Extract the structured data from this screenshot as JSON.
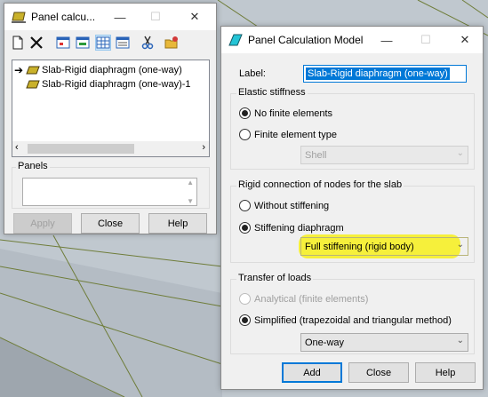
{
  "colors": {
    "accent": "#0078d7",
    "highlight": "#f6ef30",
    "slab_icon": "#c9b12a"
  },
  "small_window": {
    "title": "Panel calcu...",
    "toolbar": [
      "new-icon",
      "delete-icon",
      "view-icon-1",
      "view-icon-2",
      "view-icon-3",
      "view-icon-4",
      "scissors-icon",
      "folder-add-icon"
    ],
    "list_items": [
      {
        "label": "Slab-Rigid diaphragm (one-way)",
        "current": true
      },
      {
        "label": "Slab-Rigid diaphragm (one-way)-1",
        "current": false
      }
    ],
    "panels_label": "Panels",
    "buttons": {
      "apply": "Apply",
      "close": "Close",
      "help": "Help"
    }
  },
  "model_window": {
    "title": "Panel Calculation Model",
    "label_caption": "Label:",
    "label_value": "Slab-Rigid diaphragm (one-way)",
    "elastic": {
      "title": "Elastic stiffness",
      "opt_none": "No finite elements",
      "opt_type": "Finite element type",
      "type_value": "Shell"
    },
    "rigid": {
      "title": "Rigid connection of nodes for the slab",
      "opt_without": "Without stiffening",
      "opt_diaphragm": "Stiffening diaphragm",
      "stiffening_value": "Full stiffening (rigid body)"
    },
    "transfer": {
      "title": "Transfer of loads",
      "opt_analytical": "Analytical (finite elements)",
      "opt_simplified": "Simplified (trapezoidal and triangular method)",
      "method_value": "One-way"
    },
    "buttons": {
      "add": "Add",
      "close": "Close",
      "help": "Help"
    }
  }
}
